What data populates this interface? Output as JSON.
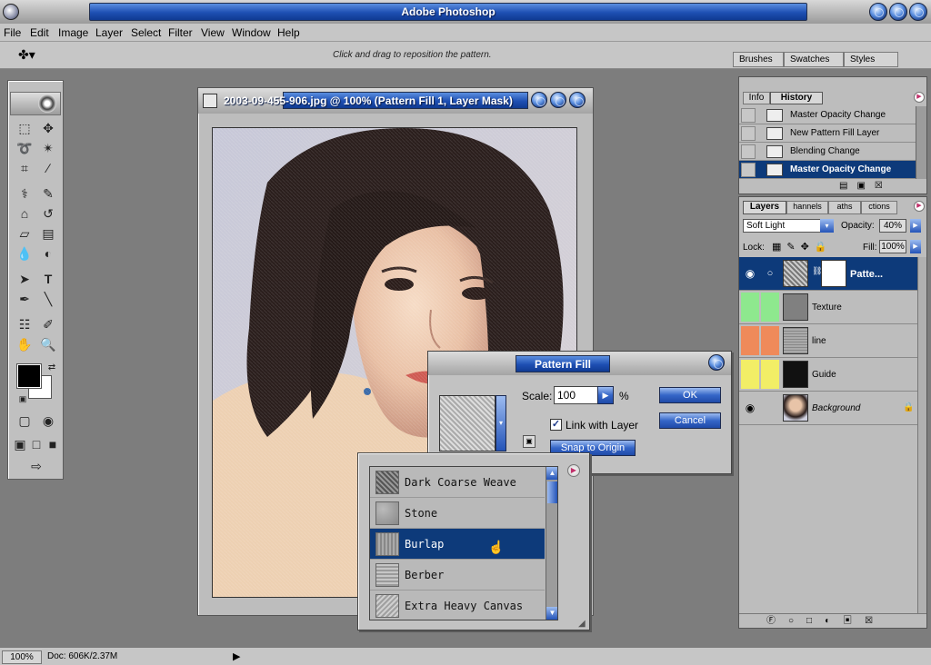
{
  "app": {
    "title": "Adobe Photoshop"
  },
  "menu": [
    "File",
    "Edit",
    "Image",
    "Layer",
    "Select",
    "Filter",
    "View",
    "Window",
    "Help"
  ],
  "options": {
    "hint": "Click and drag to reposition the pattern."
  },
  "palette_tabs": [
    "Brushes",
    "Swatches",
    "Styles"
  ],
  "document": {
    "title": "2003-09-455-906.jpg @ 100% (Pattern Fill 1, Layer Mask)"
  },
  "pattern_fill": {
    "title": "Pattern Fill",
    "scale_label": "Scale:",
    "scale_value": "100",
    "scale_unit": "%",
    "link_label": "Link with Layer",
    "snap_label": "Snap to Origin",
    "ok_label": "OK",
    "cancel_label": "Cancel"
  },
  "patterns": [
    {
      "name": "Dark Coarse Weave",
      "selected": false
    },
    {
      "name": "Stone",
      "selected": false
    },
    {
      "name": "Burlap",
      "selected": true
    },
    {
      "name": "Berber",
      "selected": false
    },
    {
      "name": "Extra Heavy Canvas",
      "selected": false
    }
  ],
  "history": {
    "tabs": [
      "Info",
      "History"
    ],
    "items": [
      {
        "label": "Master Opacity Change",
        "selected": false
      },
      {
        "label": "New Pattern Fill Layer",
        "selected": false
      },
      {
        "label": "Blending Change",
        "selected": false
      },
      {
        "label": "Master Opacity Change",
        "selected": true
      }
    ]
  },
  "layers": {
    "tabs": [
      "Layers",
      "Channels",
      "Paths",
      "Actions"
    ],
    "tabs_shown": [
      "Layers",
      "hannels",
      "aths",
      "ctions"
    ],
    "blend_mode": "Soft Light",
    "opacity_label": "Opacity:",
    "opacity_value": "40%",
    "lock_label": "Lock:",
    "fill_label": "Fill:",
    "fill_value": "100%",
    "items": [
      {
        "name": "Patte...",
        "selected": true,
        "color": "#0d3a7a"
      },
      {
        "name": "Texture",
        "selected": false,
        "color": "#8ee88e"
      },
      {
        "name": "line",
        "selected": false,
        "color": "#ef8a5a"
      },
      {
        "name": "Guide",
        "selected": false,
        "color": "#f2ee66"
      },
      {
        "name": "Background",
        "selected": false,
        "color": "#bdbdbd"
      }
    ]
  },
  "status": {
    "zoom": "100%",
    "doc": "Doc: 606K/2.37M"
  },
  "colors": {
    "accent": "#1e4fb3",
    "selection": "#0d3a7a",
    "chrome": "#c6c6c6",
    "workspace": "#7d7d7d"
  }
}
